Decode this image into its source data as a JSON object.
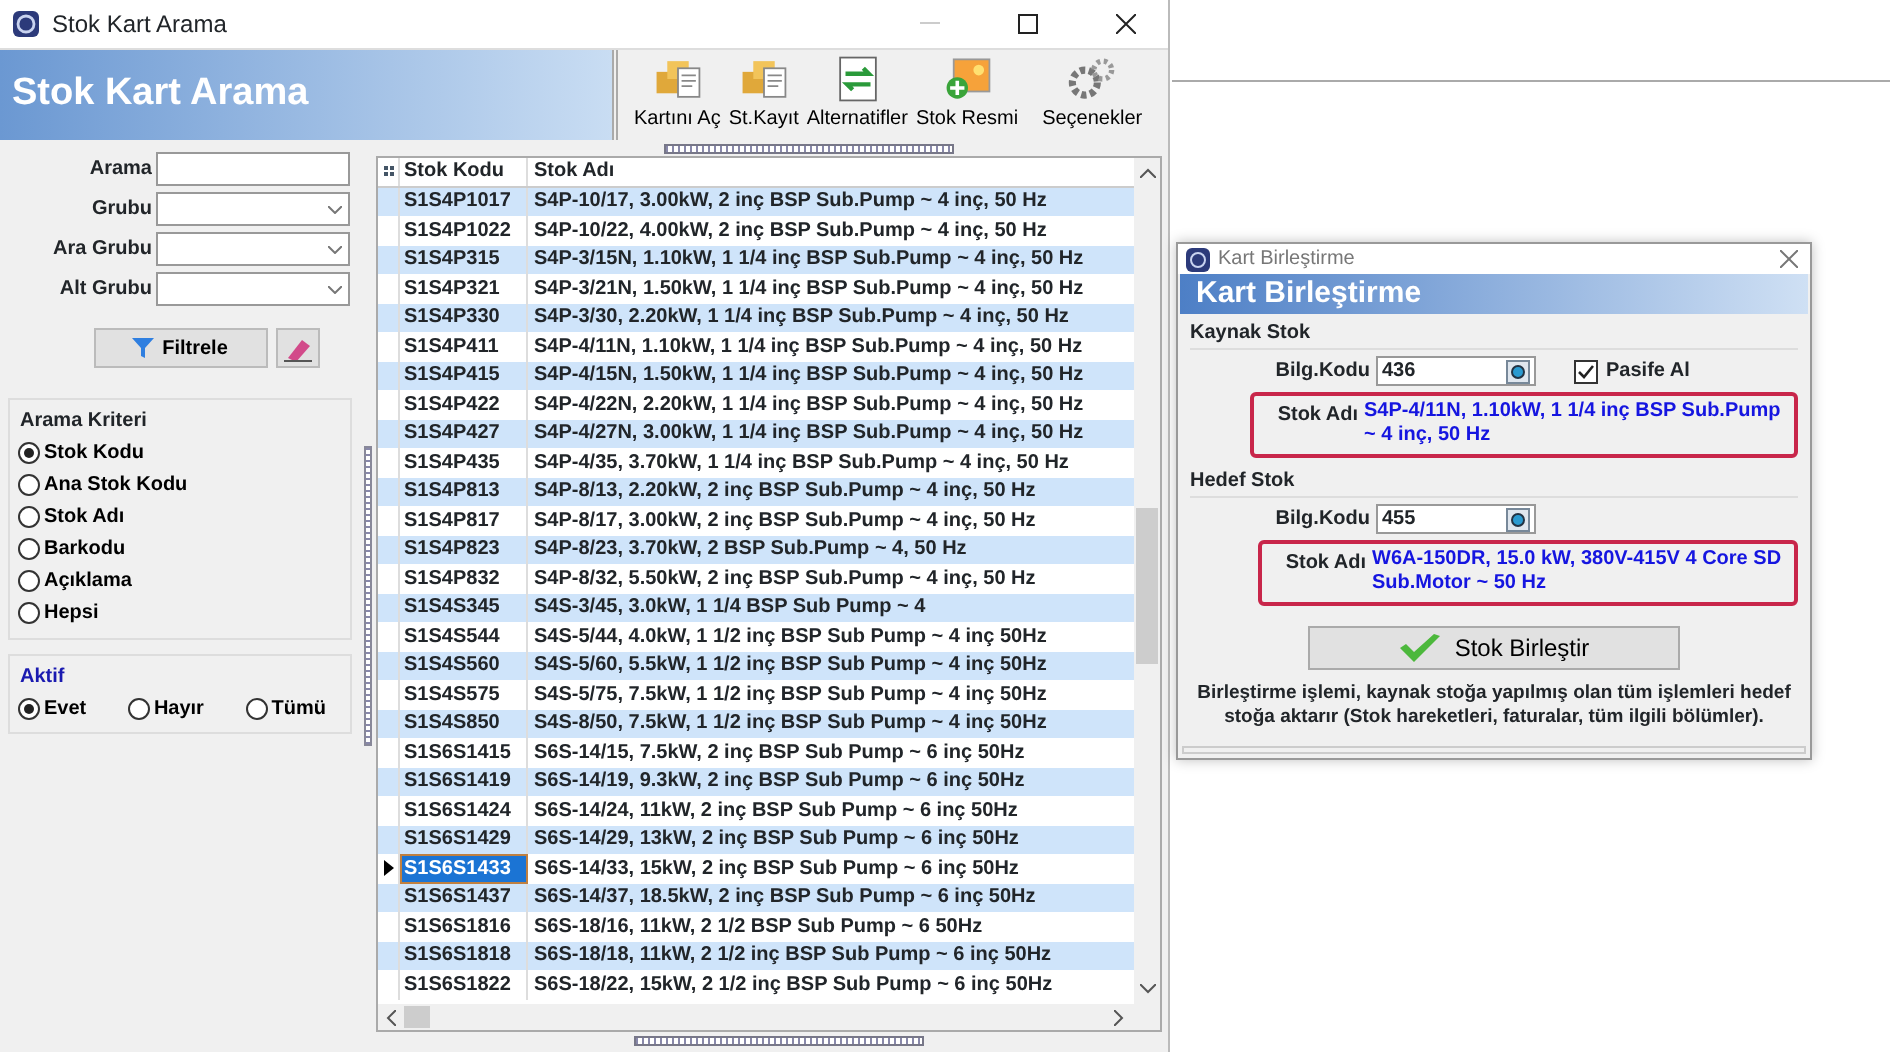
{
  "window": {
    "title": "Stok Kart Arama"
  },
  "header": {
    "title": "Stok Kart Arama"
  },
  "toolbar": [
    "Kartını Aç",
    "St.Kayıt",
    "Alternatifler",
    "Stok Resmi",
    "Seçenekler"
  ],
  "filters": [
    {
      "label": "Arama",
      "kind": "text"
    },
    {
      "label": "Grubu",
      "kind": "select"
    },
    {
      "label": "Ara Grubu",
      "kind": "select"
    },
    {
      "label": "Alt Grubu",
      "kind": "select"
    }
  ],
  "filter_button": "Filtrele",
  "search_criteria": {
    "title": "Arama Kriteri",
    "options": [
      {
        "label": "Stok Kodu",
        "selected": true
      },
      {
        "label": "Ana Stok Kodu",
        "selected": false
      },
      {
        "label": "Stok Adı",
        "selected": false
      },
      {
        "label": "Barkodu",
        "selected": false
      },
      {
        "label": "Açıklama",
        "selected": false
      },
      {
        "label": "Hepsi",
        "selected": false
      }
    ]
  },
  "active": {
    "title": "Aktif",
    "options": [
      {
        "label": "Evet",
        "selected": true
      },
      {
        "label": "Hayır",
        "selected": false
      },
      {
        "label": "Tümü",
        "selected": false
      }
    ]
  },
  "grid": {
    "columns": [
      "Stok Kodu",
      "Stok Adı"
    ],
    "rows": [
      {
        "code": "S1S4P1017",
        "name": "S4P-10/17, 3.00kW, 2 inç BSP Sub.Pump ~ 4 inç, 50 Hz",
        "selected": false
      },
      {
        "code": "S1S4P1022",
        "name": "S4P-10/22, 4.00kW, 2 inç BSP Sub.Pump ~ 4 inç, 50 Hz",
        "selected": false
      },
      {
        "code": "S1S4P315",
        "name": "S4P-3/15N, 1.10kW, 1 1/4 inç BSP Sub.Pump ~ 4 inç, 50 Hz",
        "selected": false
      },
      {
        "code": "S1S4P321",
        "name": "S4P-3/21N, 1.50kW, 1 1/4 inç BSP Sub.Pump ~ 4 inç, 50 Hz",
        "selected": false
      },
      {
        "code": "S1S4P330",
        "name": "S4P-3/30, 2.20kW, 1 1/4 inç BSP Sub.Pump ~ 4 inç, 50 Hz",
        "selected": false
      },
      {
        "code": "S1S4P411",
        "name": "S4P-4/11N, 1.10kW, 1 1/4 inç BSP Sub.Pump ~ 4 inç, 50 Hz",
        "selected": false
      },
      {
        "code": "S1S4P415",
        "name": "S4P-4/15N, 1.50kW, 1 1/4 inç BSP Sub.Pump ~ 4 inç, 50 Hz",
        "selected": false
      },
      {
        "code": "S1S4P422",
        "name": "S4P-4/22N, 2.20kW, 1 1/4 inç BSP Sub.Pump ~ 4 inç, 50 Hz",
        "selected": false
      },
      {
        "code": "S1S4P427",
        "name": "S4P-4/27N, 3.00kW, 1 1/4 inç BSP Sub.Pump ~ 4 inç, 50 Hz",
        "selected": false
      },
      {
        "code": "S1S4P435",
        "name": "S4P-4/35, 3.70kW, 1 1/4 inç BSP Sub.Pump ~ 4 inç, 50 Hz",
        "selected": false
      },
      {
        "code": "S1S4P813",
        "name": "S4P-8/13, 2.20kW, 2 inç BSP Sub.Pump ~ 4 inç, 50 Hz",
        "selected": false
      },
      {
        "code": "S1S4P817",
        "name": "S4P-8/17, 3.00kW, 2 inç BSP Sub.Pump ~ 4 inç, 50 Hz",
        "selected": false
      },
      {
        "code": "S1S4P823",
        "name": "S4P-8/23, 3.70kW, 2 BSP Sub.Pump ~ 4, 50 Hz",
        "selected": false
      },
      {
        "code": "S1S4P832",
        "name": "S4P-8/32, 5.50kW, 2 inç BSP Sub.Pump ~ 4 inç, 50 Hz",
        "selected": false
      },
      {
        "code": "S1S4S345",
        "name": "S4S-3/45, 3.0kW, 1 1/4 BSP Sub Pump ~ 4",
        "selected": false
      },
      {
        "code": "S1S4S544",
        "name": "S4S-5/44, 4.0kW, 1 1/2 inç BSP Sub Pump ~ 4 inç 50Hz",
        "selected": false
      },
      {
        "code": "S1S4S560",
        "name": "S4S-5/60, 5.5kW, 1 1/2 inç BSP Sub Pump ~ 4 inç 50Hz",
        "selected": false
      },
      {
        "code": "S1S4S575",
        "name": "S4S-5/75, 7.5kW, 1 1/2 inç BSP Sub Pump ~ 4 inç 50Hz",
        "selected": false
      },
      {
        "code": "S1S4S850",
        "name": "S4S-8/50, 7.5kW, 1 1/2 inç BSP Sub Pump ~ 4 inç 50Hz",
        "selected": false
      },
      {
        "code": "S1S6S1415",
        "name": "S6S-14/15, 7.5kW, 2 inç BSP Sub Pump ~ 6 inç 50Hz",
        "selected": false
      },
      {
        "code": "S1S6S1419",
        "name": "S6S-14/19, 9.3kW, 2 inç BSP Sub Pump ~ 6 inç 50Hz",
        "selected": false
      },
      {
        "code": "S1S6S1424",
        "name": "S6S-14/24, 11kW, 2 inç BSP Sub Pump ~ 6 inç 50Hz",
        "selected": false
      },
      {
        "code": "S1S6S1429",
        "name": "S6S-14/29, 13kW, 2 inç BSP Sub Pump ~ 6 inç 50Hz",
        "selected": false
      },
      {
        "code": "S1S6S1433",
        "name": "S6S-14/33, 15kW, 2 inç BSP Sub Pump ~ 6 inç 50Hz",
        "selected": true
      },
      {
        "code": "S1S6S1437",
        "name": "S6S-14/37, 18.5kW, 2 inç BSP Sub Pump ~ 6 inç 50Hz",
        "selected": false
      },
      {
        "code": "S1S6S1816",
        "name": "S6S-18/16, 11kW, 2 1/2 BSP Sub Pump ~ 6 50Hz",
        "selected": false
      },
      {
        "code": "S1S6S1818",
        "name": "S6S-18/18, 11kW, 2 1/2 inç BSP Sub Pump ~ 6 inç 50Hz",
        "selected": false
      },
      {
        "code": "S1S6S1822",
        "name": "S6S-18/22, 15kW, 2 1/2 inç BSP Sub Pump ~ 6 inç 50Hz",
        "selected": false
      }
    ]
  },
  "dialog": {
    "title": "Kart Birleştirme",
    "header": "Kart Birleştirme",
    "source": {
      "title": "Kaynak Stok",
      "code_label": "Bilg.Kodu",
      "code": "436",
      "passive_label": "Pasife Al",
      "passive_checked": true,
      "name_label": "Stok Adı",
      "name": "S4P-4/11N, 1.10kW, 1 1/4 inç BSP Sub.Pump ~ 4 inç, 50 Hz"
    },
    "target": {
      "title": "Hedef Stok",
      "code_label": "Bilg.Kodu",
      "code": "455",
      "name_label": "Stok Adı",
      "name": "W6A-150DR, 15.0 kW, 380V-415V 4 Core SD Sub.Motor ~ 50 Hz"
    },
    "button": "Stok Birleştir",
    "note": "Birleştirme işlemi, kaynak stoğa yapılmış olan tüm işlemleri hedef stoğa aktarır (Stok hareketleri, faturalar, tüm ilgili bölümler)."
  }
}
